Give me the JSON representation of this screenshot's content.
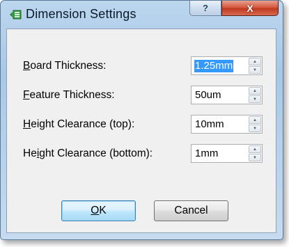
{
  "window": {
    "title": "Dimension Settings",
    "help_label": "?",
    "close_label": "X"
  },
  "fields": [
    {
      "mnemonic": "B",
      "rest": "oard Thickness:",
      "value": "1.25mm",
      "selected": true
    },
    {
      "mnemonic": "F",
      "rest": "eature Thickness:",
      "value": "50um",
      "selected": false
    },
    {
      "mnemonic": "H",
      "rest": "eight Clearance (top):",
      "value": "10mm",
      "selected": false
    },
    {
      "prefix": "He",
      "mnemonic": "i",
      "rest": "ght Clearance (bottom):",
      "value": "1mm",
      "selected": false
    }
  ],
  "buttons": {
    "ok_mnemonic": "O",
    "ok_rest": "K",
    "cancel_label": "Cancel"
  },
  "icons": {
    "app": "dimension-app-icon",
    "spin_up": "spin-up-arrow-icon",
    "spin_down": "spin-down-arrow-icon"
  }
}
